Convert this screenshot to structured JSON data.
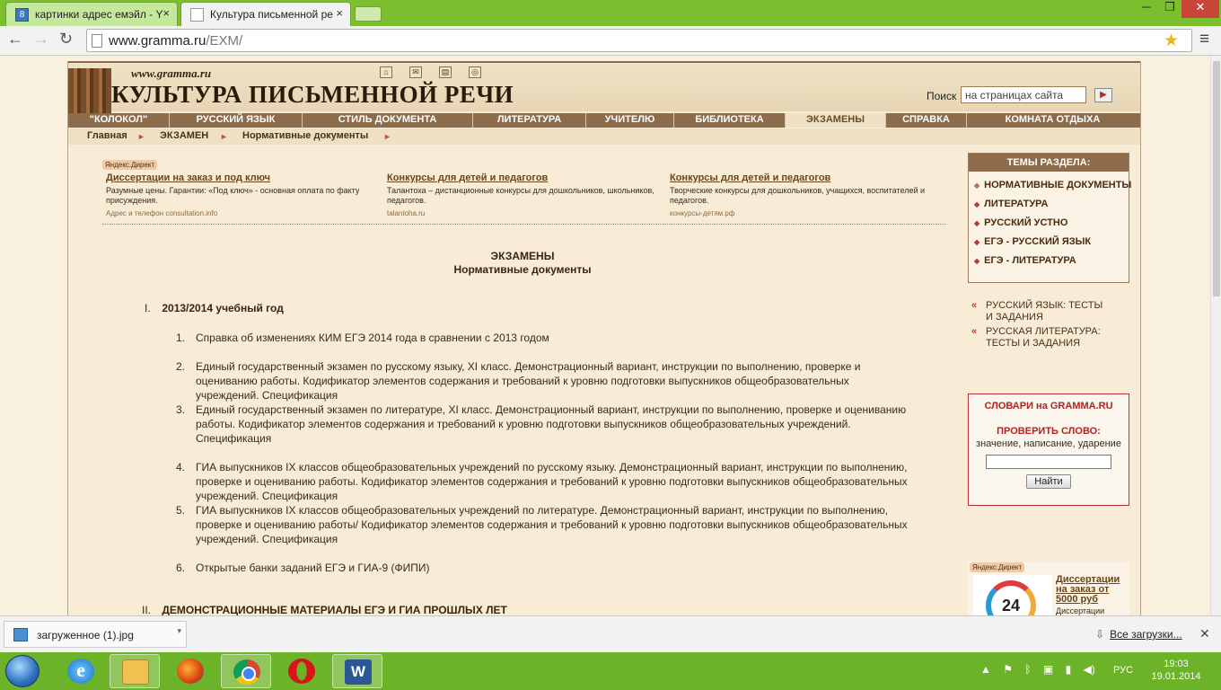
{
  "browser": {
    "tabs": [
      {
        "label": "картинки адрес емэйл - Y",
        "favicon": "8"
      },
      {
        "label": "Культура письменной ре"
      }
    ],
    "url_host": "www.gramma.ru",
    "url_path": "/EXM/"
  },
  "site": {
    "url": "www.gramma.ru",
    "title": "КУЛЬТУРА ПИСЬМЕННОЙ РЕЧИ",
    "search_label": "Поиск",
    "search_value": "на страницах сайта",
    "nav": [
      {
        "label": "\"КОЛОКОЛ\"",
        "active": false
      },
      {
        "label": "РУССКИЙ ЯЗЫК",
        "active": false
      },
      {
        "label": "СТИЛЬ ДОКУМЕНТА",
        "active": false
      },
      {
        "label": "ЛИТЕРАТУРА",
        "active": false
      },
      {
        "label": "УЧИТЕЛЮ",
        "active": false
      },
      {
        "label": "БИБЛИОТЕКА",
        "active": false
      },
      {
        "label": "ЭКЗАМЕНЫ",
        "active": true
      },
      {
        "label": "СПРАВКА",
        "active": false
      },
      {
        "label": "КОМНАТА ОТДЫХА",
        "active": false
      }
    ],
    "breadcrumbs": [
      "Главная",
      "ЭКЗАМЕН",
      "Нормативные документы"
    ]
  },
  "ads": {
    "label": "Яндекс.Директ",
    "items": [
      {
        "title": "Диссертации на заказ и под ключ",
        "text": "Разумные цены. Гарантии: «Под ключ» - основная оплата по факту присуждения.",
        "url": "Адрес и телефон  consultation.info"
      },
      {
        "title": "Конкурсы для детей и педагогов",
        "text": "Талантоха – дистанционные конкурсы для дошкольников, школьников, педагогов.",
        "url": "talantoha.ru"
      },
      {
        "title": "Конкурсы для детей и педагогов",
        "text": "Творческие конкурсы для дошкольников, учащихся, воспитателей и педагогов.",
        "url": "конкурсы-детям.рф"
      }
    ]
  },
  "content": {
    "heading": "ЭКЗАМЕНЫ",
    "subheading": "Нормативные документы",
    "section1": {
      "num": "I.",
      "title": "2013/2014 учебный год"
    },
    "items": [
      {
        "n": "1.",
        "text": "Справка об изменениях КИМ ЕГЭ 2014 года в сравнении с 2013 годом"
      },
      {
        "n": "2.",
        "text": "Единый государственный экзамен по русскому языку, XI класс. Демонстрационный вариант, инструкции по выполнению, проверке и оцениванию работы. Кодификатор элементов содержания и требований к уровню подготовки выпускников общеобразовательных учреждений. Спецификация"
      },
      {
        "n": "3.",
        "text": "Единый государственный экзамен по литературе, XI класс. Демонстрационный вариант, инструкции по выполнению, проверке и оцениванию работы. Кодификатор элементов содержания и требований к уровню подготовки выпускников общеобразовательных учреждений. Спецификация"
      },
      {
        "n": "4.",
        "text": "ГИА выпускников IX классов общеобразовательных учреждений по русскому языку. Демонстрационный вариант, инструкции по выполнению, проверке и оцениванию работы. Кодификатор элементов содержания и требований к уровню подготовки выпускников общеобразовательных учреждений. Спецификация"
      },
      {
        "n": "5.",
        "text": "ГИА выпускников IX классов общеобразовательных учреждений по литературе. Демонстрационный вариант, инструкции по выполнению, проверке и оцениванию работы/ Кодификатор элементов содержания и требований к уровню подготовки выпускников общеобразовательных учреждений. Спецификация"
      },
      {
        "n": "6.",
        "text": "Открытые банки заданий ЕГЭ и ГИА-9 (ФИПИ)"
      }
    ],
    "section2": {
      "num": "II.",
      "title": "ДЕМОНСТРАЦИОННЫЕ МАТЕРИАЛЫ ЕГЭ И ГИА ПРОШЛЫХ ЛЕТ"
    }
  },
  "sidebar": {
    "themes_title": "ТЕМЫ РАЗДЕЛА:",
    "themes": [
      "НОРМАТИВНЫЕ ДОКУМЕНТЫ",
      "ЛИТЕРАТУРА",
      "РУССКИЙ УСТНО",
      "ЕГЭ - РУССКИЙ ЯЗЫК",
      "ЕГЭ - ЛИТЕРАТУРА"
    ],
    "links": [
      "РУССКИЙ ЯЗЫК: ТЕСТЫ И ЗАДАНИЯ",
      "РУССКАЯ ЛИТЕРАТУРА: ТЕСТЫ И ЗАДАНИЯ"
    ],
    "dict_title": "СЛОВАРИ на GRAMMA.RU",
    "dict_check": "ПРОВЕРИТЬ СЛОВО:",
    "dict_sub": "значение, написание, ударение",
    "dict_button": "Найти",
    "ad_label": "Яндекс.Директ",
    "ad_badge": "24",
    "ad_title": "Диссертации на заказ от 5000 руб",
    "ad_text": "Диссертации"
  },
  "downloads": {
    "file": "загруженное (1).jpg",
    "all_label": "Все загрузки..."
  },
  "taskbar": {
    "lang": "РУС",
    "time": "19:03",
    "date": "19.01.2014"
  }
}
